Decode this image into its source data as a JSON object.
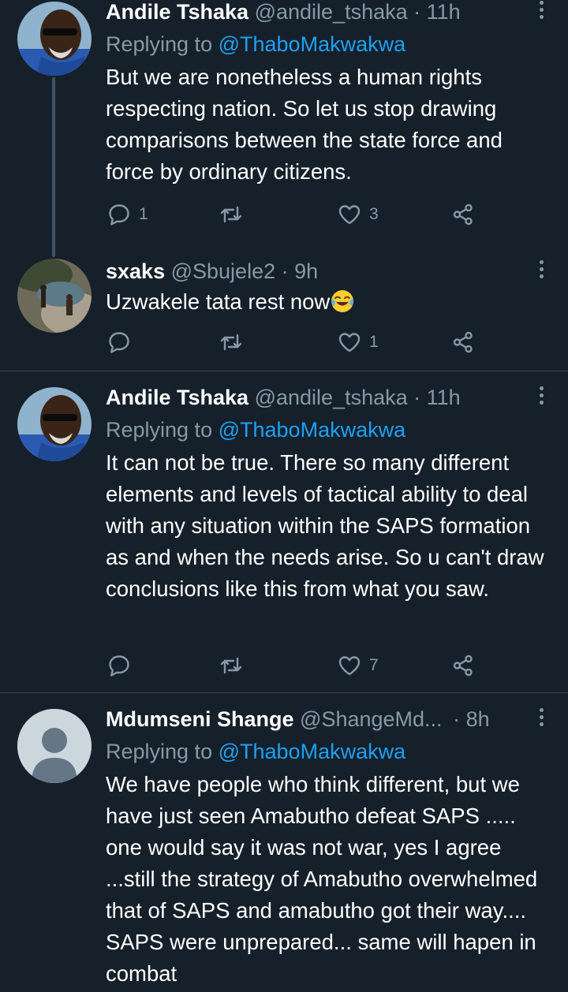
{
  "tweets": [
    {
      "name": "Andile Tshaka",
      "handle": "@andile_tshaka",
      "separator": "·",
      "time": "11h",
      "replying_prefix": "Replying to",
      "replying_to": "@ThaboMakwakwa",
      "text": "But we are nonetheless a human rights respecting nation. So let us stop drawing comparisons between the state force and force by ordinary citizens.",
      "replies": "1",
      "retweets": "",
      "likes": "3"
    },
    {
      "name": "sxaks",
      "handle": "@Sbujele2",
      "separator": "·",
      "time": "9h",
      "text": "Uzwakele tata rest now",
      "emoji": "face-with-tears-of-joy",
      "replies": "",
      "retweets": "",
      "likes": "1"
    },
    {
      "name": "Andile Tshaka",
      "handle": "@andile_tshaka",
      "separator": "·",
      "time": "11h",
      "replying_prefix": "Replying to",
      "replying_to": "@ThaboMakwakwa",
      "text": "It can not be true. There so many different elements and levels of tactical ability to deal with any situation within the SAPS formation as and when the needs arise. So u can't draw conclusions like this from what you saw.",
      "replies": "",
      "retweets": "",
      "likes": "7"
    },
    {
      "name": "Mdumseni Shange",
      "handle": "@ShangeMd...",
      "separator": "·",
      "time": "8h",
      "replying_prefix": "Replying to",
      "replying_to": "@ThaboMakwakwa",
      "text": "We have people who think different, but we have just seen Amabutho defeat SAPS ..... one would say it was not war, yes I agree ...still the strategy of Amabutho overwhelmed that of SAPS and amabutho got their way.... SAPS were unprepared... same will hapen in combat"
    }
  ],
  "icons": {
    "reply": "speech-bubble-icon",
    "retweet": "retweet-icon",
    "like": "heart-icon",
    "share": "share-icon",
    "more": "more-vertical-icon"
  },
  "colors": {
    "background": "#15202b",
    "secondary_text": "#8899a6",
    "mention": "#1da1f2",
    "divider": "#38444d"
  }
}
